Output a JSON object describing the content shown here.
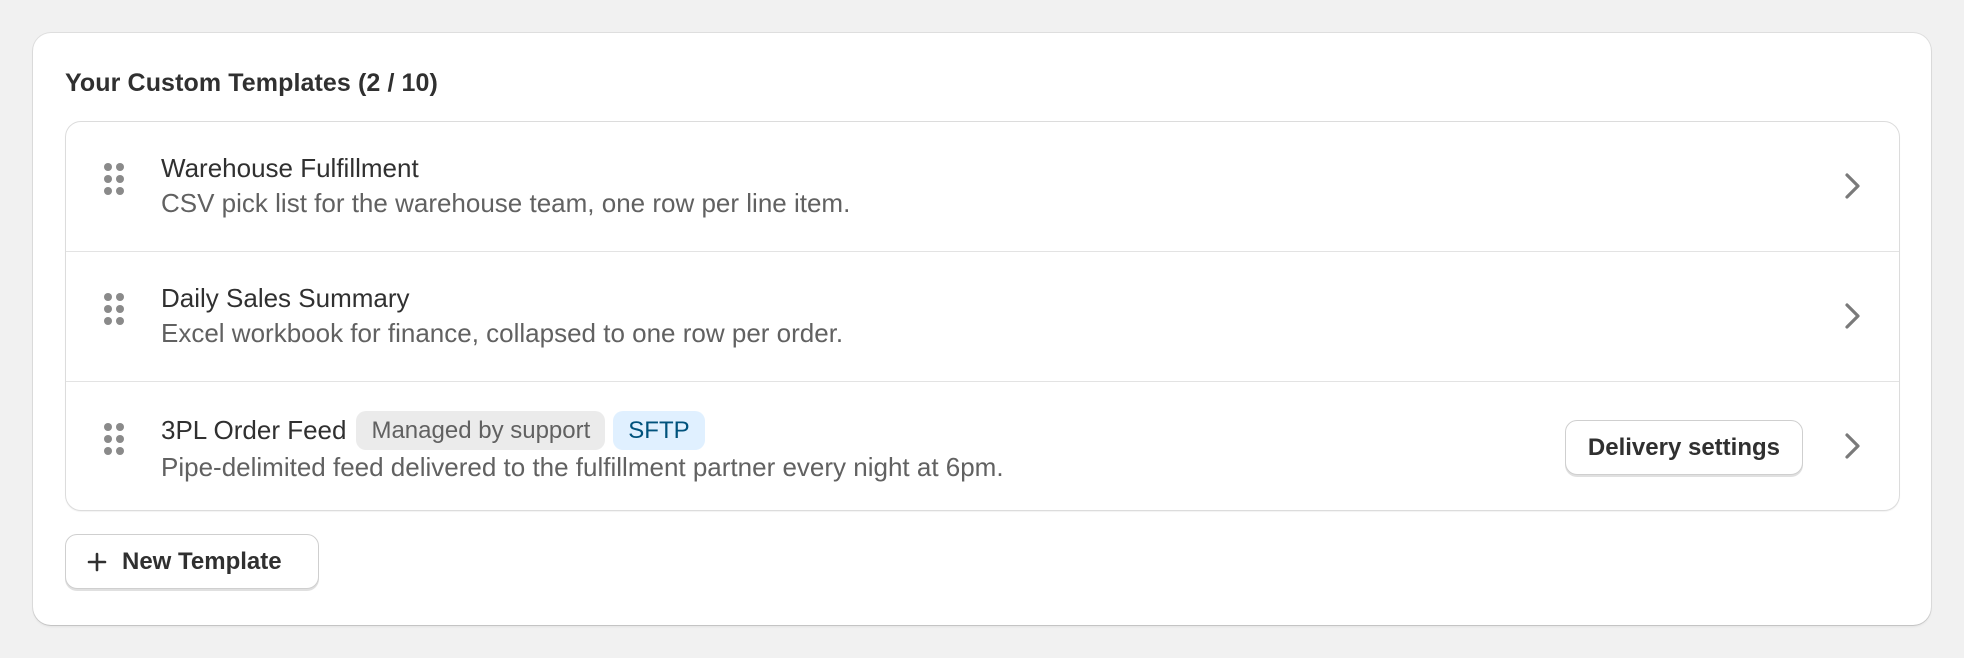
{
  "section": {
    "title": "Your Custom Templates (2 / 10)"
  },
  "templates": [
    {
      "name": "Warehouse Fulfillment",
      "description": "CSV pick list for the warehouse team, one row per line item.",
      "badges": []
    },
    {
      "name": "Daily Sales Summary",
      "description": "Excel workbook for finance, collapsed to one row per order.",
      "badges": []
    },
    {
      "name": "3PL Order Feed",
      "description": "Pipe-delimited feed delivered to the fulfillment partner every night at 6pm.",
      "badges": [
        {
          "label": "Managed by support",
          "tone": "neutral"
        },
        {
          "label": "SFTP",
          "tone": "info"
        }
      ],
      "action_label": "Delivery settings"
    }
  ],
  "actions": {
    "new_template_label": "New Template"
  },
  "icons": {
    "drag": "drag-handle-icon",
    "chevron": "chevron-right-icon",
    "plus": "plus-icon"
  },
  "colors": {
    "info_badge_bg": "#e0f0ff",
    "info_badge_text": "#00527c",
    "neutral_badge_bg": "#ebebeb"
  }
}
